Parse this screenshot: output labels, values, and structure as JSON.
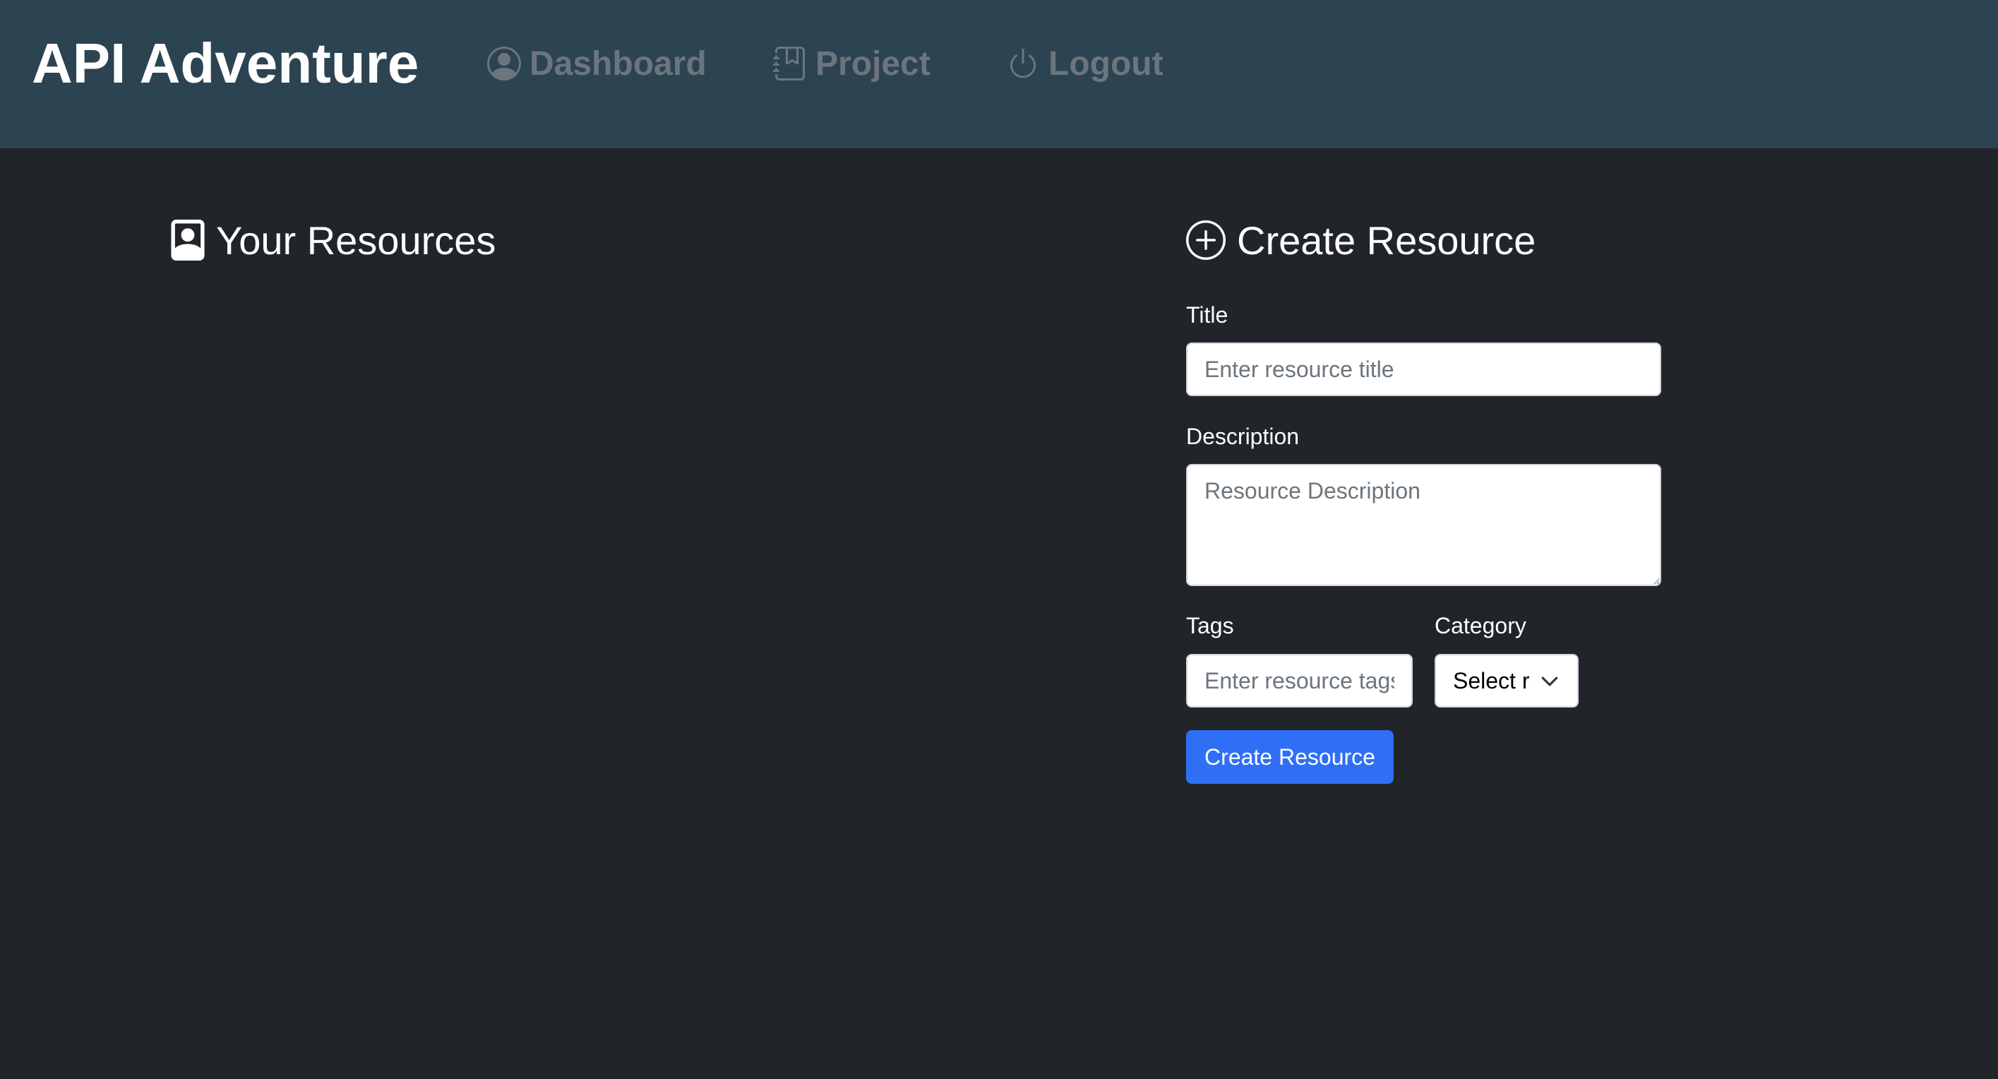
{
  "navbar": {
    "brand": "API Adventure",
    "items": [
      {
        "label": "Dashboard",
        "icon": "person-circle-icon"
      },
      {
        "label": "Project",
        "icon": "journal-bookmark-icon"
      },
      {
        "label": "Logout",
        "icon": "power-icon"
      }
    ]
  },
  "resources": {
    "title": "Your Resources",
    "icon": "person-badge-icon"
  },
  "create": {
    "title": "Create Resource",
    "icon": "plus-circle-icon",
    "title_label": "Title",
    "title_placeholder": "Enter resource title",
    "description_label": "Description",
    "description_placeholder": "Resource Description",
    "tags_label": "Tags",
    "tags_placeholder": "Enter resource tags",
    "category_label": "Category",
    "category_selected": "Select resource category",
    "submit_label": "Create Resource"
  },
  "colors": {
    "navbar_bg": "#2c4352",
    "page_bg": "#212529",
    "nav_text": "#6c757d",
    "primary": "#2f6ff5"
  }
}
